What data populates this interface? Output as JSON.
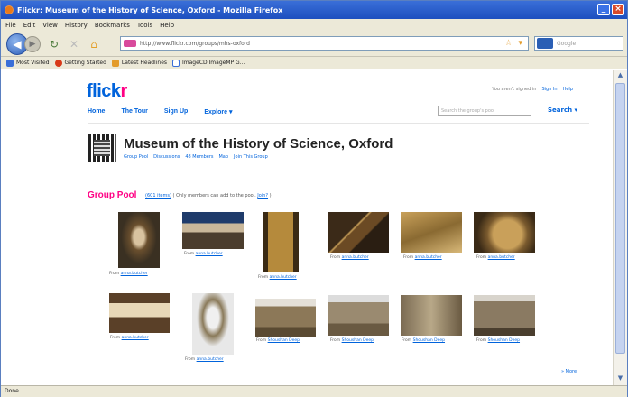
{
  "window": {
    "title": "Flickr: Museum of the History of Science, Oxford - Mozilla Firefox",
    "buttons": [
      "_",
      "×"
    ]
  },
  "menubar": [
    "File",
    "Edit",
    "View",
    "History",
    "Bookmarks",
    "Tools",
    "Help"
  ],
  "url": "http://www.flickr.com/groups/mhs-oxford",
  "search_placeholder": "Google",
  "bookmarks": [
    {
      "label": "Most Visited",
      "color": "#3a6fd8"
    },
    {
      "label": "Getting Started",
      "color": "#d83a1a"
    },
    {
      "label": "Latest Headlines",
      "color": "#e39b2a"
    },
    {
      "label": "ImageCD ImageMP G...",
      "color": "#3a6fd8"
    }
  ],
  "status": "Done",
  "flickr": {
    "logo_a": "flick",
    "logo_b": "r",
    "toplinks": [
      "You aren't signed in",
      "Sign In",
      "Help"
    ],
    "nav": [
      "Home",
      "The Tour",
      "Sign Up",
      "Explore ▾"
    ],
    "search_placeholder": "Search the group's pool",
    "search_button": "Search ▾"
  },
  "group": {
    "title": "Museum of the History of Science, Oxford",
    "sublinks": [
      "Group Pool",
      "Discussions",
      "48 Members",
      "Map",
      "Join This Group"
    ]
  },
  "pool": {
    "heading": "Group Pool",
    "count_link": "(601 items)",
    "note": "( Only members can add to the pool.",
    "join_link": "Join?",
    "note_end": ")"
  },
  "photos": [
    {
      "from": "From",
      "user": "anna.butcher"
    },
    {
      "from": "From",
      "user": "anna.butcher"
    },
    {
      "from": "From",
      "user": "anna.butcher"
    },
    {
      "from": "From",
      "user": "anna.butcher"
    },
    {
      "from": "From",
      "user": "anna.butcher"
    },
    {
      "from": "From",
      "user": "anna.butcher"
    },
    {
      "from": "From",
      "user": "anna.butcher"
    },
    {
      "from": "From",
      "user": "anna.butcher"
    },
    {
      "from": "From",
      "user": "Shoushan Deep"
    },
    {
      "from": "From",
      "user": "Shoushan Deep"
    },
    {
      "from": "From",
      "user": "Shoushan Deep"
    },
    {
      "from": "From",
      "user": "Shoushan Deep"
    }
  ],
  "more": "» More"
}
